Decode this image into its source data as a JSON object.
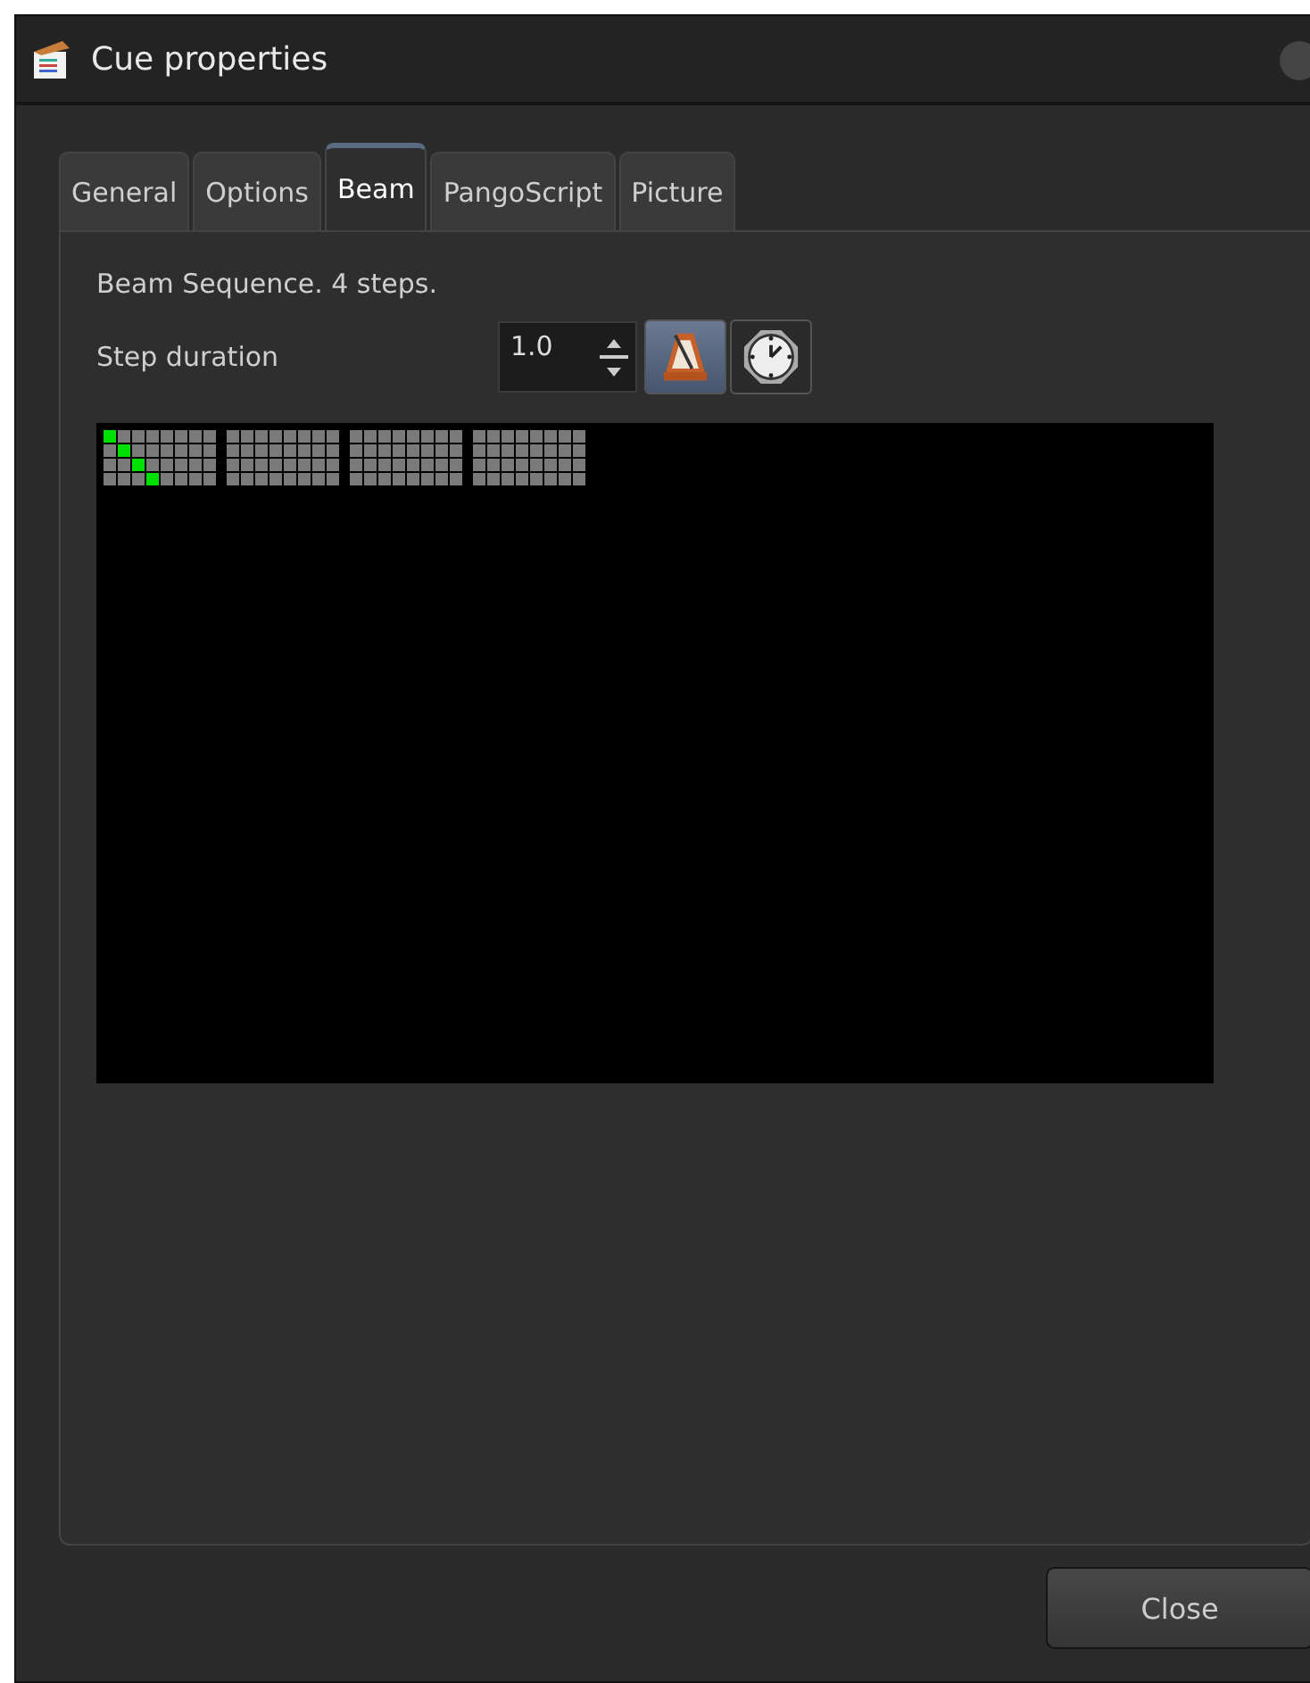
{
  "window": {
    "title": "Cue properties"
  },
  "tabs": [
    {
      "label": "General",
      "selected": false
    },
    {
      "label": "Options",
      "selected": false
    },
    {
      "label": "Beam",
      "selected": true
    },
    {
      "label": "PangoScript",
      "selected": false
    },
    {
      "label": "Picture",
      "selected": false
    }
  ],
  "summary": "Beam Sequence. 4 steps.",
  "step_duration": {
    "label": "Step duration",
    "value": "1.0",
    "modes": [
      {
        "kind": "metronome",
        "selected": true
      },
      {
        "kind": "clock",
        "selected": false
      }
    ]
  },
  "beam_steps": [
    {
      "rows": [
        [
          true,
          false,
          false,
          false,
          false,
          false,
          false,
          false
        ],
        [
          false,
          true,
          false,
          false,
          false,
          false,
          false,
          false
        ],
        [
          false,
          false,
          true,
          false,
          false,
          false,
          false,
          false
        ],
        [
          false,
          false,
          false,
          true,
          false,
          false,
          false,
          false
        ]
      ]
    },
    {
      "rows": [
        [
          false,
          false,
          false,
          false,
          false,
          false,
          false,
          false
        ],
        [
          false,
          false,
          false,
          false,
          false,
          false,
          false,
          false
        ],
        [
          false,
          false,
          false,
          false,
          false,
          false,
          false,
          false
        ],
        [
          false,
          false,
          false,
          false,
          false,
          false,
          false,
          false
        ]
      ]
    },
    {
      "rows": [
        [
          false,
          false,
          false,
          false,
          false,
          false,
          false,
          false
        ],
        [
          false,
          false,
          false,
          false,
          false,
          false,
          false,
          false
        ],
        [
          false,
          false,
          false,
          false,
          false,
          false,
          false,
          false
        ],
        [
          false,
          false,
          false,
          false,
          false,
          false,
          false,
          false
        ]
      ]
    },
    {
      "rows": [
        [
          false,
          false,
          false,
          false,
          false,
          false,
          false,
          false
        ],
        [
          false,
          false,
          false,
          false,
          false,
          false,
          false,
          false
        ],
        [
          false,
          false,
          false,
          false,
          false,
          false,
          false,
          false
        ],
        [
          false,
          false,
          false,
          false,
          false,
          false,
          false,
          false
        ]
      ]
    }
  ],
  "buttons": [
    "Close"
  ]
}
